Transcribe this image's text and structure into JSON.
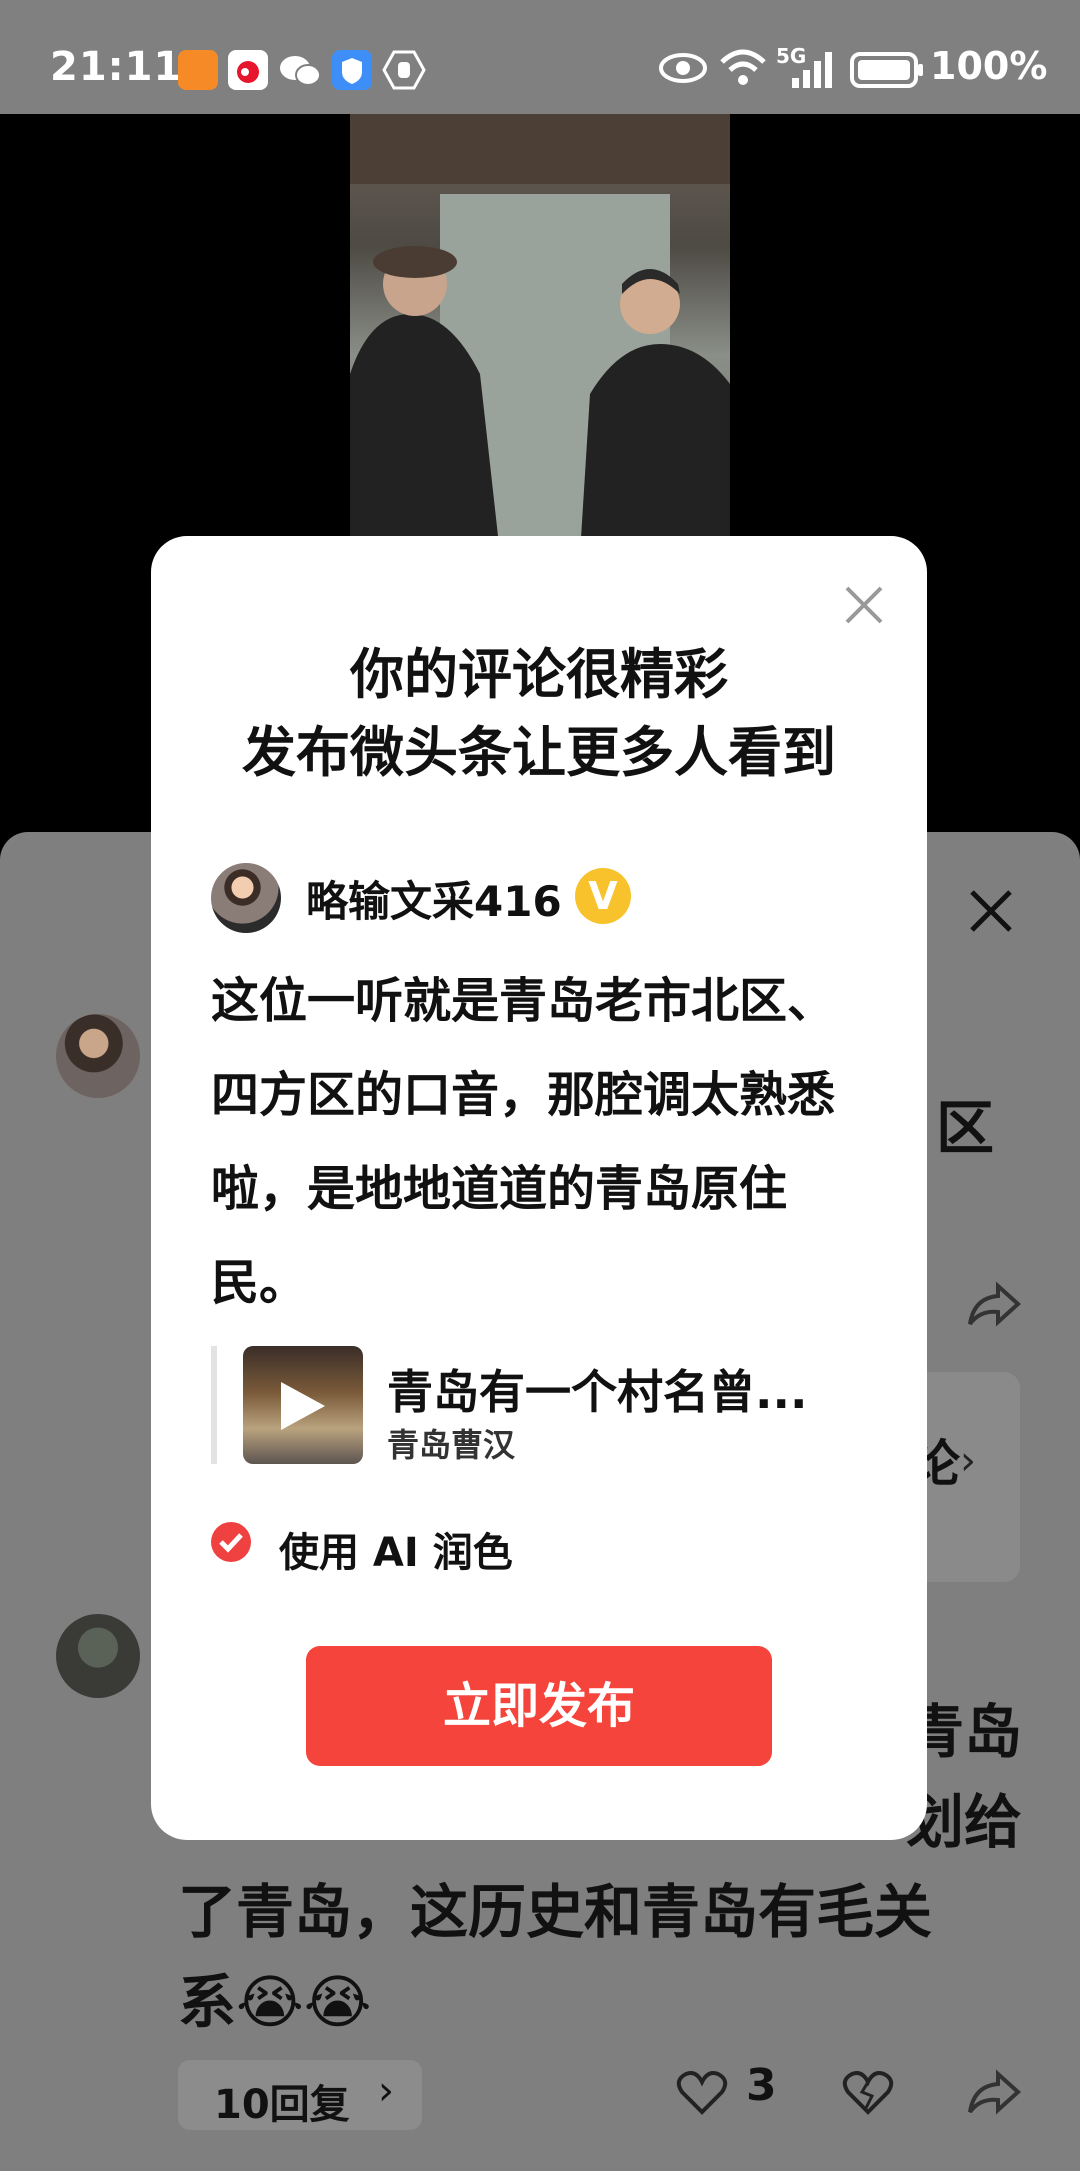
{
  "status_bar": {
    "time": "21:11",
    "battery_pct": "100%",
    "network": "5G",
    "icons": [
      "kuaishou-icon",
      "sina-icon",
      "wechat-icon",
      "security-icon",
      "hand-icon",
      "eye-icon",
      "wifi-icon",
      "signal-icon",
      "battery-icon"
    ]
  },
  "background": {
    "partial_right_text_1": "区",
    "comment2_lines": [
      "青岛",
      "划给",
      "了青岛，这历史和青岛有毛关",
      "系😭😭"
    ],
    "see_more_text": "论",
    "replies_button": "10回复",
    "like_count": "3"
  },
  "popup": {
    "title_line1": "你的评论很精彩",
    "title_line2": "发布微头条让更多人看到",
    "username": "略输文采416",
    "verified_badge": "V",
    "comment_text": "这位一听就是青岛老市北区、四方区的口音，那腔调太熟悉啦，是地地道道的青岛原住民。",
    "link_title": "青岛有一个村名曾...",
    "link_subtitle": "青岛曹汉",
    "ai_polish_label": "使用 AI 润色",
    "publish_button": "立即发布"
  },
  "colors": {
    "accent": "#f4443b",
    "verified": "#f7c22b",
    "dim_bg": "#7f7f7f"
  }
}
